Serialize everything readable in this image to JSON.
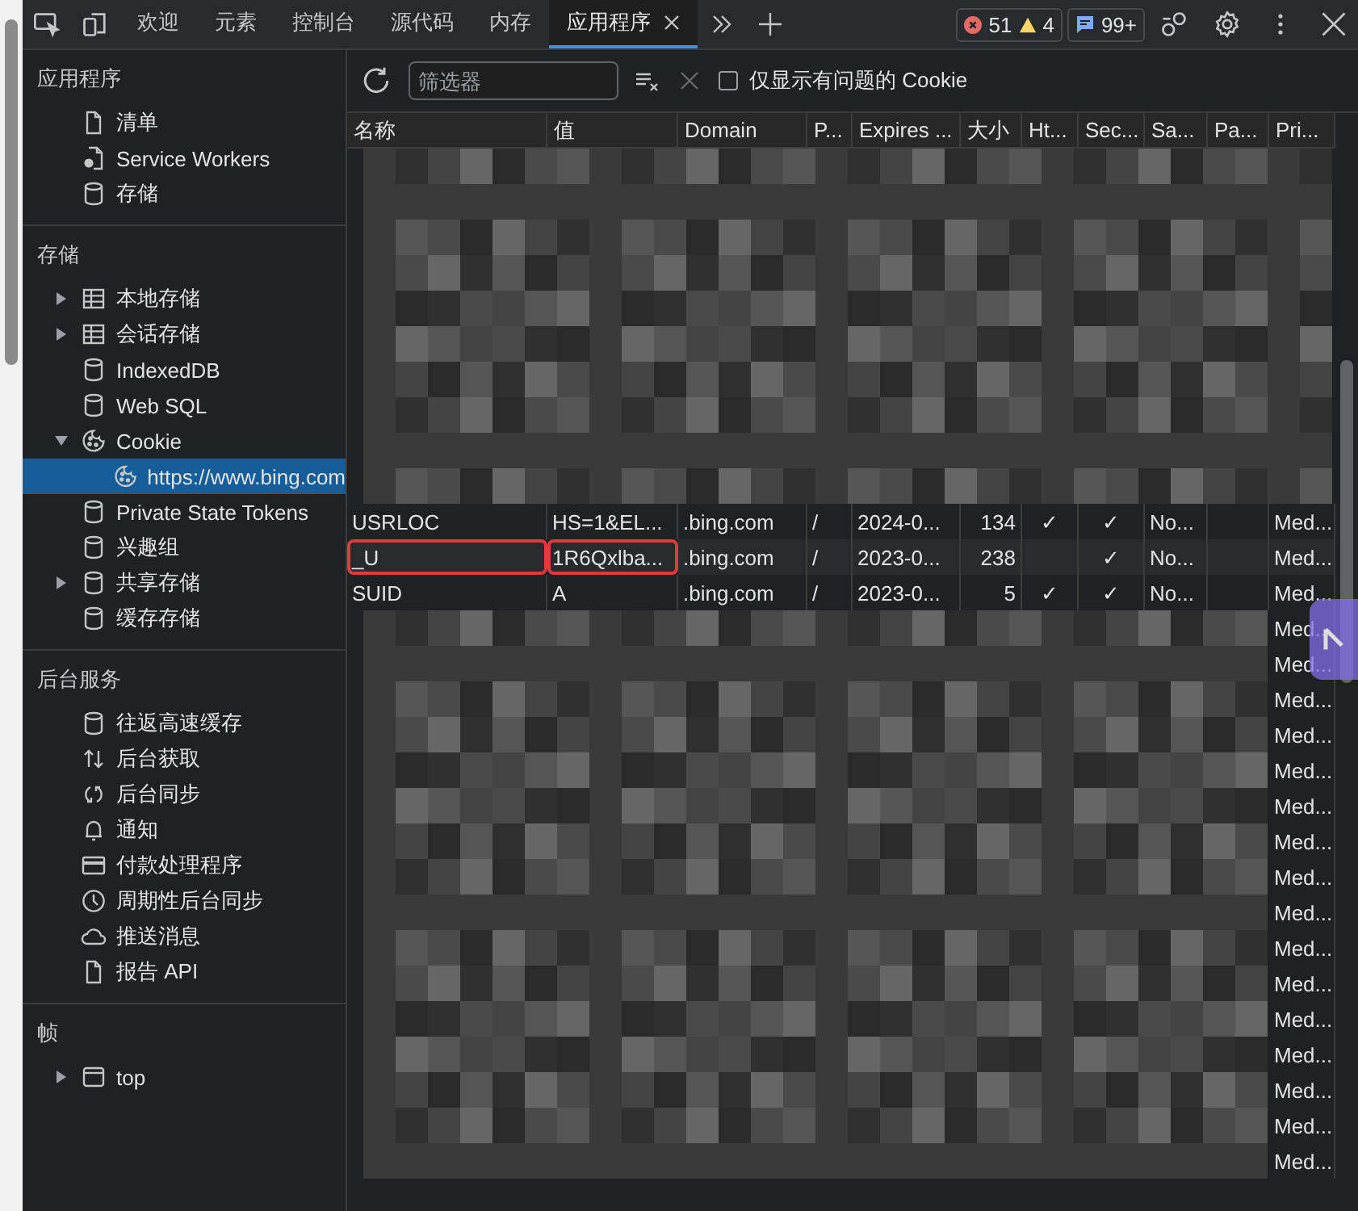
{
  "toolbar": {
    "tabs": [
      {
        "label": "欢迎",
        "selected": false
      },
      {
        "label": "元素",
        "selected": false
      },
      {
        "label": "控制台",
        "selected": false
      },
      {
        "label": "源代码",
        "selected": false
      },
      {
        "label": "内存",
        "selected": false
      },
      {
        "label": "应用程序",
        "selected": true
      }
    ],
    "errors": "51",
    "warnings": "4",
    "messages": "99+"
  },
  "sidebar": {
    "sections": [
      {
        "title": "应用程序",
        "items": [
          {
            "label": "清单",
            "kind": "document",
            "selected": false
          },
          {
            "label": "Service Workers",
            "kind": "worker",
            "selected": false
          },
          {
            "label": "存储",
            "kind": "database",
            "selected": false
          }
        ]
      },
      {
        "title": "存储",
        "items": [
          {
            "label": "本地存储",
            "kind": "table",
            "expanded": false,
            "selected": false
          },
          {
            "label": "会话存储",
            "kind": "table",
            "expanded": false,
            "selected": false
          },
          {
            "label": "IndexedDB",
            "kind": "database",
            "selected": false
          },
          {
            "label": "Web SQL",
            "kind": "database",
            "selected": false
          },
          {
            "label": "Cookie",
            "kind": "cookie",
            "expanded": true,
            "selected": false,
            "children": [
              {
                "label": "https://www.bing.com",
                "kind": "cookie",
                "selected": true
              }
            ]
          },
          {
            "label": "Private State Tokens",
            "kind": "database",
            "selected": false
          },
          {
            "label": "兴趣组",
            "kind": "database",
            "selected": false
          },
          {
            "label": "共享存储",
            "kind": "database",
            "expanded": false,
            "selected": false
          },
          {
            "label": "缓存存储",
            "kind": "database",
            "selected": false
          }
        ]
      },
      {
        "title": "后台服务",
        "items": [
          {
            "label": "往返高速缓存",
            "kind": "database",
            "selected": false
          },
          {
            "label": "后台获取",
            "kind": "fetch",
            "selected": false
          },
          {
            "label": "后台同步",
            "kind": "sync",
            "selected": false
          },
          {
            "label": "通知",
            "kind": "notification",
            "selected": false
          },
          {
            "label": "付款处理程序",
            "kind": "payment",
            "selected": false
          },
          {
            "label": "周期性后台同步",
            "kind": "periodic",
            "selected": false
          },
          {
            "label": "推送消息",
            "kind": "push",
            "selected": false
          },
          {
            "label": "报告 API",
            "kind": "document",
            "selected": false
          }
        ]
      },
      {
        "title": "帧",
        "items": [
          {
            "label": "top",
            "kind": "frame",
            "expanded": false,
            "selected": false
          }
        ]
      }
    ]
  },
  "filter": {
    "placeholder": "筛选器",
    "only_issues_label": "仅显示有问题的 Cookie",
    "only_issues_checked": false
  },
  "table": {
    "columns": [
      "名称",
      "值",
      "Domain",
      "P...",
      "Expires ...",
      "大小",
      "Ht...",
      "Sec...",
      "Sa...",
      "Pa...",
      "Pri..."
    ],
    "rows": [
      {
        "name": "USRLOC",
        "value": "HS=1&EL...",
        "domain": ".bing.com",
        "path": "/",
        "expires": "2024-0...",
        "size": "134",
        "httponly": "✓",
        "secure": "✓",
        "samesite": "No...",
        "priority": "Med...",
        "name_highlighted": false,
        "value_highlighted": false
      },
      {
        "name": "_U",
        "value": "1R6Qxlba...",
        "domain": ".bing.com",
        "path": "/",
        "expires": "2023-0...",
        "size": "238",
        "secure": "✓",
        "samesite": "No...",
        "priority": "Med...",
        "name_highlighted": true,
        "value_highlighted": true
      },
      {
        "name": "SUID",
        "value": "A",
        "domain": ".bing.com",
        "path": "/",
        "expires": "2023-0...",
        "size": "5",
        "httponly": "✓",
        "secure": "✓",
        "samesite": "No...",
        "priority": "Med...",
        "name_highlighted": false,
        "value_highlighted": false
      }
    ],
    "obscured_rows": [
      {
        "priority": "Med..."
      },
      {
        "priority": "Med..."
      },
      {
        "priority": "Med..."
      },
      {
        "priority": "Med..."
      },
      {
        "priority": "Med..."
      },
      {
        "priority": "Med..."
      },
      {
        "priority": "Med..."
      },
      {
        "priority": "Med..."
      },
      {
        "priority": "Med..."
      },
      {
        "priority": "Med..."
      },
      {
        "priority": "Med..."
      },
      {
        "priority": "Med..."
      },
      {
        "priority": "Med..."
      },
      {
        "priority": "Med..."
      },
      {
        "priority": "Med..."
      },
      {
        "priority": "Med..."
      }
    ]
  }
}
